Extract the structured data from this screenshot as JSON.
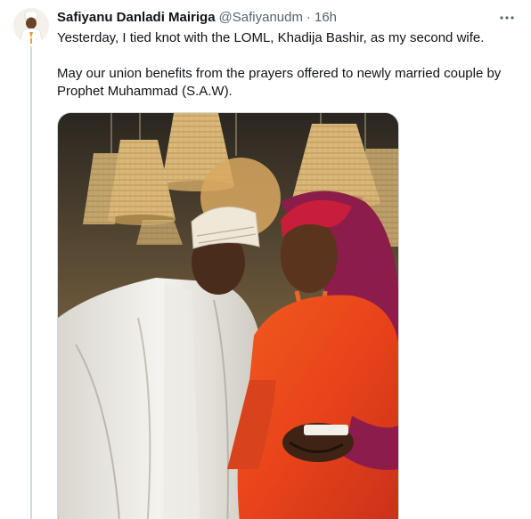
{
  "tweet": {
    "author": {
      "display_name": "Safiyanu Danladi Mairiga",
      "handle": "@Safiyanudm",
      "separator": "·",
      "timestamp": "16h"
    },
    "text": {
      "paragraph_1": "Yesterday, I tied knot with the LOML, Khadija Bashir, as my second wife.",
      "paragraph_2": "May our union benefits from the prayers offered to newly married couple by Prophet Muhammad (S.A.W)."
    },
    "media": {
      "type": "photo"
    },
    "icons": {
      "more": "more-options-icon",
      "avatar": "profile-avatar"
    },
    "colors": {
      "text_primary": "#0f1419",
      "text_secondary": "#536471",
      "border": "#cfd9de"
    }
  }
}
